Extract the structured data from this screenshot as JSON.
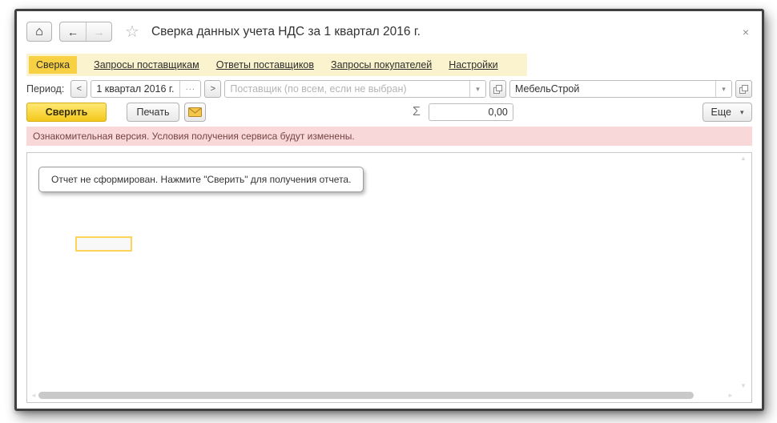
{
  "window": {
    "title": "Сверка данных учета НДС за 1 квартал 2016 г.",
    "close_icon": "×"
  },
  "nav": {
    "home_icon": "⌂",
    "back_icon": "←",
    "forward_icon": "→",
    "favorite_icon": "☆"
  },
  "tabs": [
    {
      "label": "Сверка"
    },
    {
      "label": "Запросы поставщикам"
    },
    {
      "label": "Ответы поставщиков"
    },
    {
      "label": "Запросы покупателей"
    },
    {
      "label": "Настройки"
    }
  ],
  "filters": {
    "period_label": "Период:",
    "prev_label": "<",
    "next_label": ">",
    "period_value": "1 квартал 2016 г.",
    "period_ellipsis": "...",
    "dropdown_icon": "▾",
    "supplier_placeholder": "Поставщик (по всем, если не выбран)",
    "organization_value": "МебельСтрой"
  },
  "toolbar": {
    "compare_label": "Сверить",
    "print_label": "Печать",
    "sigma_icon": "Σ",
    "total_value": "0,00",
    "more_label": "Еще",
    "more_arrow": "▾"
  },
  "notice": {
    "text": "Ознакомительная версия. Условия получения сервиса будут изменены."
  },
  "report": {
    "empty_message": "Отчет не сформирован. Нажмите \"Сверить\" для получения отчета."
  },
  "scrollbar": {
    "up_icon": "▲",
    "down_icon": "▼",
    "left_icon": "◄",
    "right_icon": "►"
  },
  "colors": {
    "active_tab": "#f7d043",
    "tabstrip_bg": "#fbf3cd",
    "accent_button": "#f4c91c",
    "notice_bg": "#f8d8d8",
    "window_border": "#404040"
  }
}
